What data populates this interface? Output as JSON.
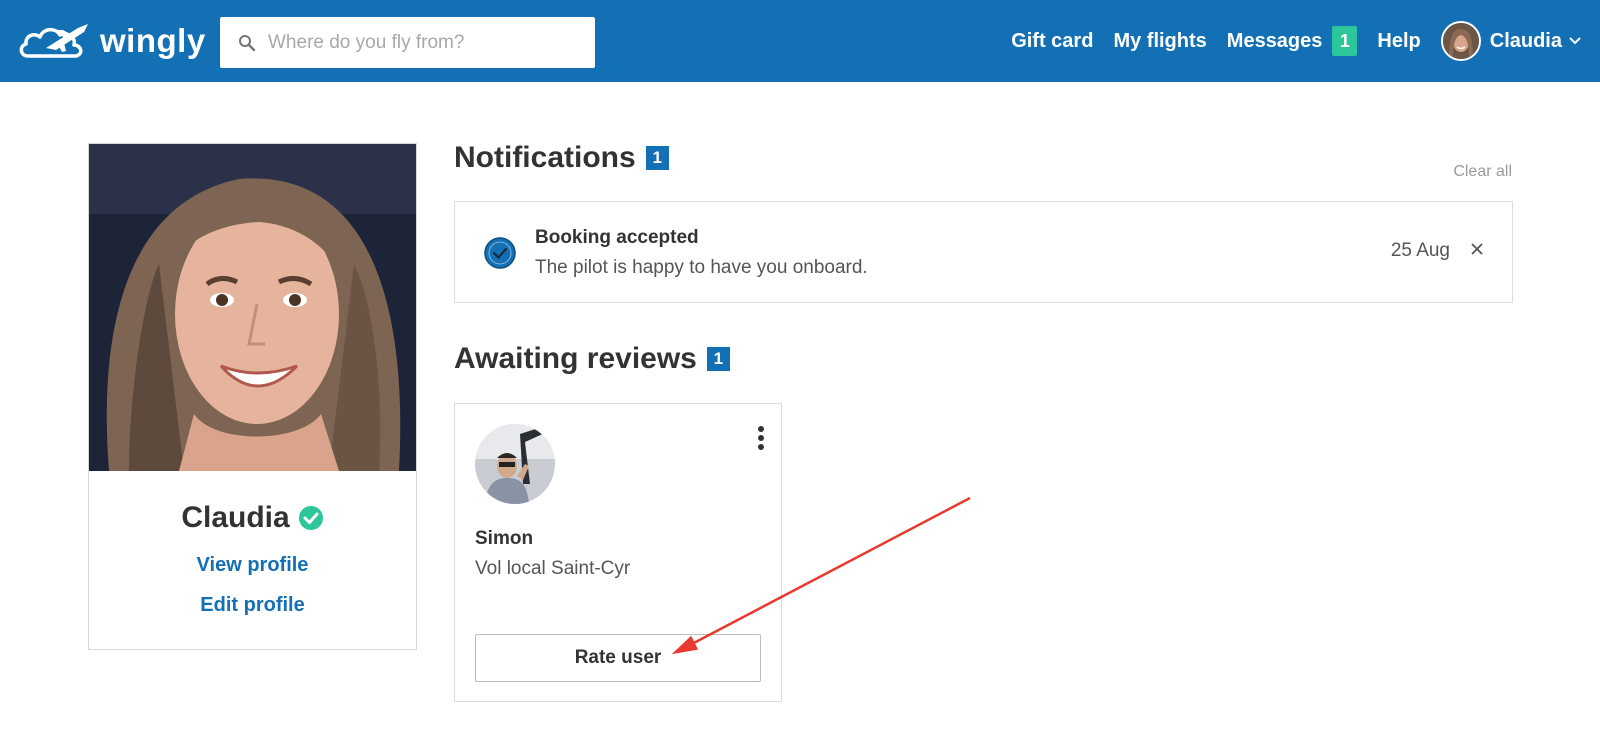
{
  "header": {
    "brand": "wingly",
    "search_placeholder": "Where do you fly from?",
    "nav": {
      "gift_card": "Gift card",
      "my_flights": "My flights",
      "messages": "Messages",
      "messages_count": "1",
      "help": "Help",
      "user_name": "Claudia"
    },
    "colors": {
      "bar": "#1470b4",
      "badge": "#2bc69a"
    }
  },
  "profile": {
    "name": "Claudia",
    "view_profile": "View profile",
    "edit_profile": "Edit profile"
  },
  "notifications": {
    "title": "Notifications",
    "count": "1",
    "clear_all": "Clear all",
    "items": [
      {
        "title": "Booking accepted",
        "body": "The pilot is happy to have you onboard.",
        "date": "25 Aug",
        "icon": "check-circle-icon"
      }
    ]
  },
  "reviews": {
    "title": "Awaiting reviews",
    "count": "1",
    "items": [
      {
        "name": "Simon",
        "flight": "Vol local Saint-Cyr",
        "button": "Rate user"
      }
    ]
  },
  "annotation": {
    "type": "arrow",
    "color": "#e8392e"
  }
}
